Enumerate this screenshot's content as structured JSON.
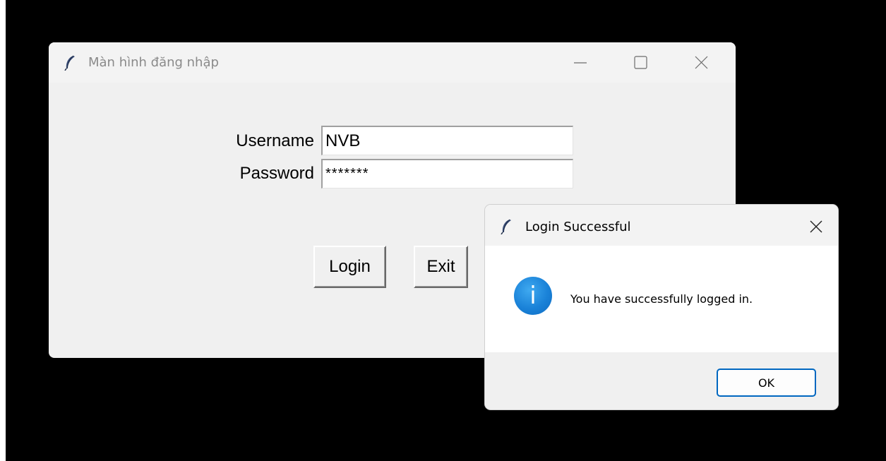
{
  "login_window": {
    "title": "Màn hình đăng nhập",
    "icon": "feather-icon",
    "controls": [
      "minimize-icon",
      "maximize-icon",
      "close-icon"
    ],
    "username_label": "Username",
    "username_value": "NVB",
    "password_label": "Password",
    "password_value": "*******",
    "login_label": "Login",
    "exit_label": "Exit"
  },
  "message_box": {
    "title": "Login Successful",
    "icon": "feather-icon",
    "info_icon": "info-icon",
    "message": "You have successfully logged in.",
    "ok_label": "OK",
    "accent": "#0067c0"
  },
  "colors": {
    "desktop": "#000000",
    "window_bg": "#f0f0f0",
    "info_blue": "#1a82d8"
  }
}
